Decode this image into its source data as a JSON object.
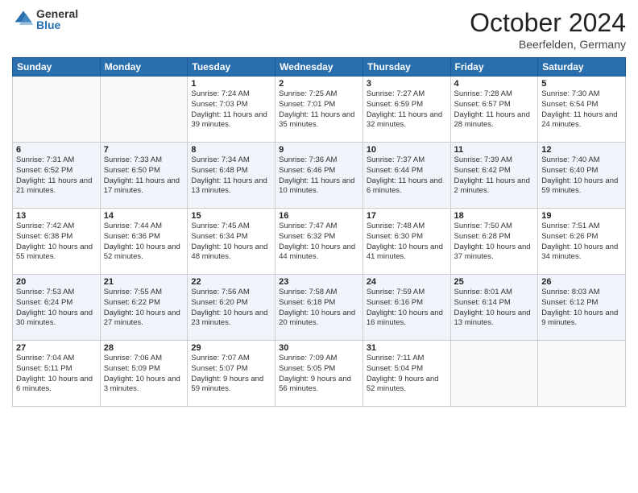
{
  "logo": {
    "general": "General",
    "blue": "Blue"
  },
  "header": {
    "month": "October 2024",
    "location": "Beerfelden, Germany"
  },
  "weekdays": [
    "Sunday",
    "Monday",
    "Tuesday",
    "Wednesday",
    "Thursday",
    "Friday",
    "Saturday"
  ],
  "weeks": [
    [
      {
        "day": "",
        "info": ""
      },
      {
        "day": "",
        "info": ""
      },
      {
        "day": "1",
        "info": "Sunrise: 7:24 AM\nSunset: 7:03 PM\nDaylight: 11 hours and 39 minutes."
      },
      {
        "day": "2",
        "info": "Sunrise: 7:25 AM\nSunset: 7:01 PM\nDaylight: 11 hours and 35 minutes."
      },
      {
        "day": "3",
        "info": "Sunrise: 7:27 AM\nSunset: 6:59 PM\nDaylight: 11 hours and 32 minutes."
      },
      {
        "day": "4",
        "info": "Sunrise: 7:28 AM\nSunset: 6:57 PM\nDaylight: 11 hours and 28 minutes."
      },
      {
        "day": "5",
        "info": "Sunrise: 7:30 AM\nSunset: 6:54 PM\nDaylight: 11 hours and 24 minutes."
      }
    ],
    [
      {
        "day": "6",
        "info": "Sunrise: 7:31 AM\nSunset: 6:52 PM\nDaylight: 11 hours and 21 minutes."
      },
      {
        "day": "7",
        "info": "Sunrise: 7:33 AM\nSunset: 6:50 PM\nDaylight: 11 hours and 17 minutes."
      },
      {
        "day": "8",
        "info": "Sunrise: 7:34 AM\nSunset: 6:48 PM\nDaylight: 11 hours and 13 minutes."
      },
      {
        "day": "9",
        "info": "Sunrise: 7:36 AM\nSunset: 6:46 PM\nDaylight: 11 hours and 10 minutes."
      },
      {
        "day": "10",
        "info": "Sunrise: 7:37 AM\nSunset: 6:44 PM\nDaylight: 11 hours and 6 minutes."
      },
      {
        "day": "11",
        "info": "Sunrise: 7:39 AM\nSunset: 6:42 PM\nDaylight: 11 hours and 2 minutes."
      },
      {
        "day": "12",
        "info": "Sunrise: 7:40 AM\nSunset: 6:40 PM\nDaylight: 10 hours and 59 minutes."
      }
    ],
    [
      {
        "day": "13",
        "info": "Sunrise: 7:42 AM\nSunset: 6:38 PM\nDaylight: 10 hours and 55 minutes."
      },
      {
        "day": "14",
        "info": "Sunrise: 7:44 AM\nSunset: 6:36 PM\nDaylight: 10 hours and 52 minutes."
      },
      {
        "day": "15",
        "info": "Sunrise: 7:45 AM\nSunset: 6:34 PM\nDaylight: 10 hours and 48 minutes."
      },
      {
        "day": "16",
        "info": "Sunrise: 7:47 AM\nSunset: 6:32 PM\nDaylight: 10 hours and 44 minutes."
      },
      {
        "day": "17",
        "info": "Sunrise: 7:48 AM\nSunset: 6:30 PM\nDaylight: 10 hours and 41 minutes."
      },
      {
        "day": "18",
        "info": "Sunrise: 7:50 AM\nSunset: 6:28 PM\nDaylight: 10 hours and 37 minutes."
      },
      {
        "day": "19",
        "info": "Sunrise: 7:51 AM\nSunset: 6:26 PM\nDaylight: 10 hours and 34 minutes."
      }
    ],
    [
      {
        "day": "20",
        "info": "Sunrise: 7:53 AM\nSunset: 6:24 PM\nDaylight: 10 hours and 30 minutes."
      },
      {
        "day": "21",
        "info": "Sunrise: 7:55 AM\nSunset: 6:22 PM\nDaylight: 10 hours and 27 minutes."
      },
      {
        "day": "22",
        "info": "Sunrise: 7:56 AM\nSunset: 6:20 PM\nDaylight: 10 hours and 23 minutes."
      },
      {
        "day": "23",
        "info": "Sunrise: 7:58 AM\nSunset: 6:18 PM\nDaylight: 10 hours and 20 minutes."
      },
      {
        "day": "24",
        "info": "Sunrise: 7:59 AM\nSunset: 6:16 PM\nDaylight: 10 hours and 16 minutes."
      },
      {
        "day": "25",
        "info": "Sunrise: 8:01 AM\nSunset: 6:14 PM\nDaylight: 10 hours and 13 minutes."
      },
      {
        "day": "26",
        "info": "Sunrise: 8:03 AM\nSunset: 6:12 PM\nDaylight: 10 hours and 9 minutes."
      }
    ],
    [
      {
        "day": "27",
        "info": "Sunrise: 7:04 AM\nSunset: 5:11 PM\nDaylight: 10 hours and 6 minutes."
      },
      {
        "day": "28",
        "info": "Sunrise: 7:06 AM\nSunset: 5:09 PM\nDaylight: 10 hours and 3 minutes."
      },
      {
        "day": "29",
        "info": "Sunrise: 7:07 AM\nSunset: 5:07 PM\nDaylight: 9 hours and 59 minutes."
      },
      {
        "day": "30",
        "info": "Sunrise: 7:09 AM\nSunset: 5:05 PM\nDaylight: 9 hours and 56 minutes."
      },
      {
        "day": "31",
        "info": "Sunrise: 7:11 AM\nSunset: 5:04 PM\nDaylight: 9 hours and 52 minutes."
      },
      {
        "day": "",
        "info": ""
      },
      {
        "day": "",
        "info": ""
      }
    ]
  ]
}
